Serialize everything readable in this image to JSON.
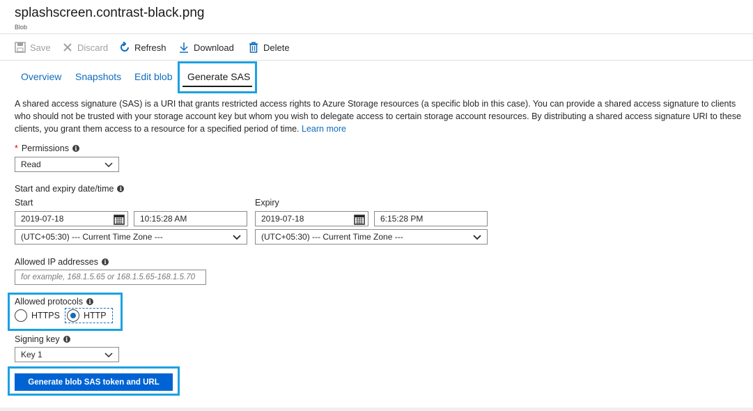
{
  "header": {
    "title": "splashscreen.contrast-black.png",
    "subtitle": "Blob"
  },
  "toolbar": {
    "save": "Save",
    "discard": "Discard",
    "refresh": "Refresh",
    "download": "Download",
    "delete": "Delete"
  },
  "tabs": [
    {
      "label": "Overview"
    },
    {
      "label": "Snapshots"
    },
    {
      "label": "Edit blob"
    },
    {
      "label": "Generate SAS",
      "active": true
    }
  ],
  "description": {
    "text": "A shared access signature (SAS) is a URI that grants restricted access rights to Azure Storage resources (a specific blob in this case). You can provide a shared access signature to clients who should not be trusted with your storage account key but whom you wish to delegate access to certain storage account resources. By distributing a shared access signature URI to these clients, you grant them access to a resource for a specified period of time.",
    "link": "Learn more"
  },
  "permissions": {
    "required_mark": "*",
    "label": "Permissions",
    "value": "Read"
  },
  "datetime": {
    "label": "Start and expiry date/time",
    "start_label": "Start",
    "start_date": "2019-07-18",
    "start_time": "10:15:28 AM",
    "start_tz": "(UTC+05:30) --- Current Time Zone ---",
    "expiry_label": "Expiry",
    "expiry_date": "2019-07-18",
    "expiry_time": "6:15:28 PM",
    "expiry_tz": "(UTC+05:30) --- Current Time Zone ---"
  },
  "ip": {
    "label": "Allowed IP addresses",
    "placeholder": "for example, 168.1.5.65 or 168.1.5.65-168.1.5.70"
  },
  "protocols": {
    "label": "Allowed protocols",
    "options": [
      "HTTPS",
      "HTTP"
    ],
    "selected": "HTTP"
  },
  "signing_key": {
    "label": "Signing key",
    "value": "Key 1"
  },
  "generate_button": "Generate blob SAS token and URL",
  "colors": {
    "accent": "#0f6cbd",
    "highlight": "#1ba1e2",
    "button": "#0063d3"
  }
}
